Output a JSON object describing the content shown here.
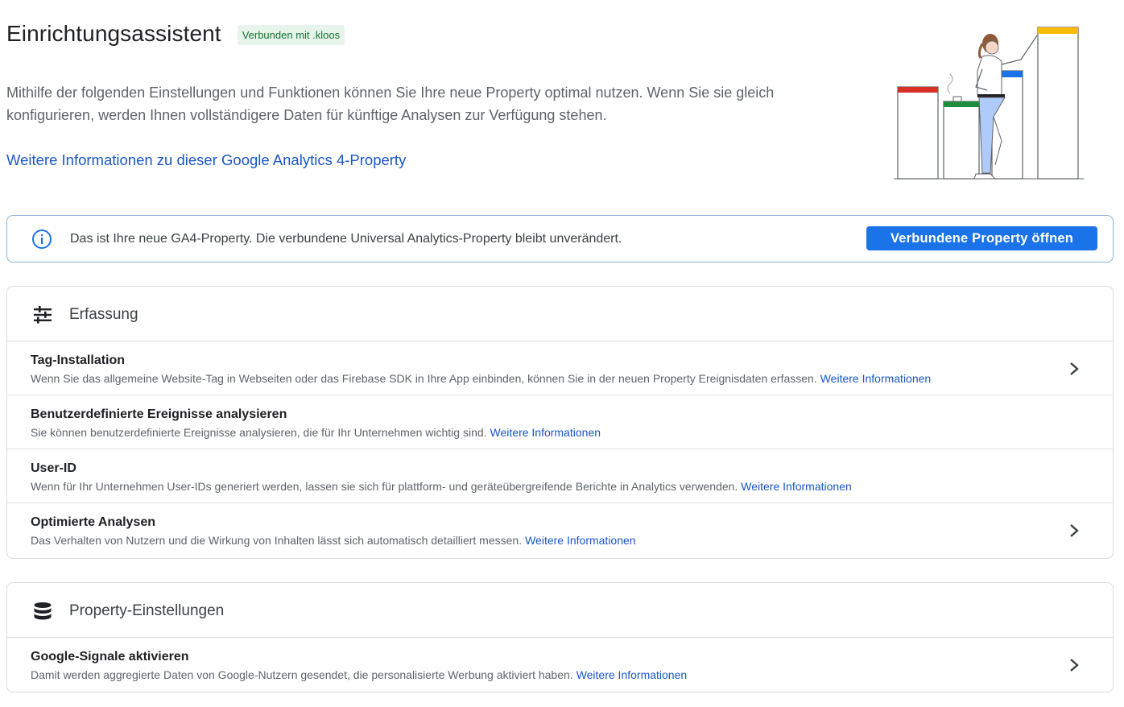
{
  "header": {
    "title": "Einrichtungsassistent",
    "badge": "Verbunden mit .kloos"
  },
  "intro": {
    "text": "Mithilfe der folgenden Einstellungen und Funktionen können Sie Ihre neue Property optimal nutzen. Wenn Sie sie gleich konfigurieren, werden Ihnen vollständigere Daten für künftige Analysen zur Verfügung stehen.",
    "link": "Weitere Informationen zu dieser Google Analytics 4-Property"
  },
  "banner": {
    "text": "Das ist Ihre neue GA4-Property. Die verbundene Universal Analytics-Property bleibt unverändert.",
    "button": "Verbundene Property öffnen"
  },
  "sections": {
    "erfassung": {
      "title": "Erfassung",
      "rows": [
        {
          "title": "Tag-Installation",
          "desc": "Wenn Sie das allgemeine Website-Tag in Webseiten oder das Firebase SDK in Ihre App einbinden, können Sie in der neuen Property Ereignisdaten erfassen.",
          "link": "Weitere Informationen"
        },
        {
          "title": "Benutzerdefinierte Ereignisse analysieren",
          "desc": "Sie können benutzerdefinierte Ereignisse analysieren, die für Ihr Unternehmen wichtig sind.",
          "link": "Weitere Informationen"
        },
        {
          "title": "User-ID",
          "desc": "Wenn für Ihr Unternehmen User-IDs generiert werden, lassen sie sich für plattform- und geräteübergreifende Berichte in Analytics verwenden.",
          "link": "Weitere Informationen"
        },
        {
          "title": "Optimierte Analysen",
          "desc": "Das Verhalten von Nutzern und die Wirkung von Inhalten lässt sich automatisch detailliert messen.",
          "link": "Weitere Informationen"
        }
      ]
    },
    "property": {
      "title": "Property-Einstellungen",
      "rows": [
        {
          "title": "Google-Signale aktivieren",
          "desc": "Damit werden aggregierte Daten von Google-Nutzern gesendet, die personalisierte Werbung aktiviert haben.",
          "link": "Weitere Informationen"
        }
      ]
    }
  },
  "icons": {
    "info": "info-circle-icon",
    "erfassung": "tune-sliders-icon",
    "property": "database-icon",
    "chevron": "chevron-right-icon"
  },
  "colors": {
    "accent": "#1a73e8",
    "link": "#1a57c7",
    "badge_bg": "#e6f4ea",
    "badge_text": "#137333"
  }
}
